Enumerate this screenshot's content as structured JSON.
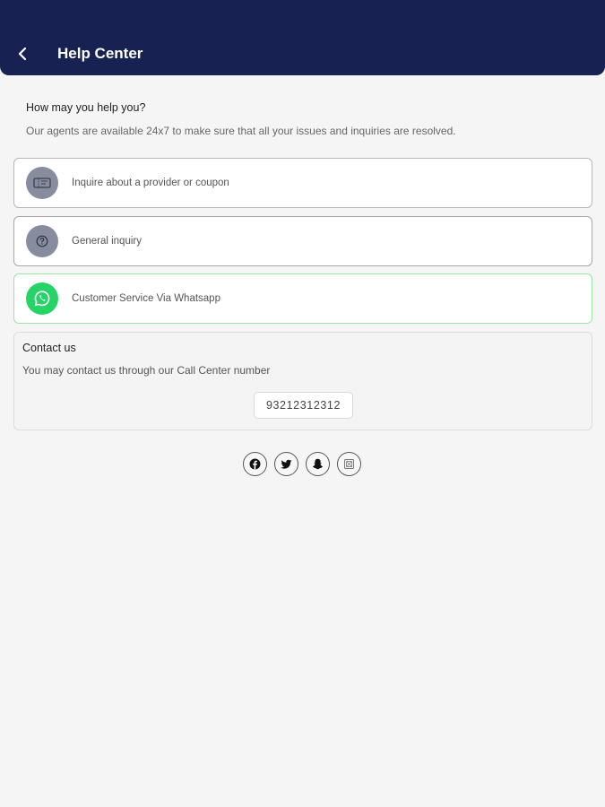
{
  "header": {
    "title": "Help Center",
    "back_icon": "chevron-left-icon",
    "background": "#172253"
  },
  "intro": {
    "title": "How may you help you?",
    "subtitle": "Our agents are available 24x7 to make sure that all your issues and inquiries are resolved."
  },
  "options": [
    {
      "label": "Inquire about a provider or coupon",
      "icon": "ticket-icon"
    },
    {
      "label": "General inquiry",
      "icon": "question-icon"
    },
    {
      "label": "Customer Service Via Whatsapp",
      "icon": "whatsapp-icon",
      "accent": "#25d366"
    }
  ],
  "contact": {
    "title": "Contact us",
    "subtitle": "You may contact us through our Call Center number",
    "phone": "93212312312"
  },
  "socials": [
    {
      "icon": "facebook-icon"
    },
    {
      "icon": "twitter-icon"
    },
    {
      "icon": "snapchat-icon"
    },
    {
      "icon": "instagram-icon"
    }
  ]
}
